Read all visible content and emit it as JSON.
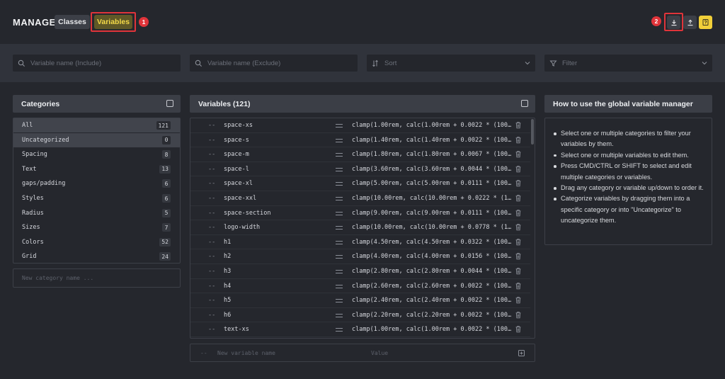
{
  "header": {
    "title": "MANAGE",
    "tabs": [
      {
        "label": "Classes",
        "active": false
      },
      {
        "label": "Variables",
        "active": true
      }
    ],
    "annotations": [
      "1",
      "2"
    ],
    "icons": [
      "download-icon",
      "upload-icon",
      "help-book-icon"
    ]
  },
  "filters": [
    {
      "placeholder": "Variable name (Include)",
      "icon": "search-icon"
    },
    {
      "placeholder": "Variable name (Exclude)",
      "icon": "search-icon"
    },
    {
      "placeholder": "Sort",
      "icon": "sort-icon"
    },
    {
      "placeholder": "Filter",
      "icon": "filter-icon"
    }
  ],
  "categories": {
    "title": "Categories",
    "items": [
      {
        "name": "All",
        "count": "121"
      },
      {
        "name": "Uncategorized",
        "count": "0"
      },
      {
        "name": "Spacing",
        "count": "8"
      },
      {
        "name": "Text",
        "count": "13"
      },
      {
        "name": "gaps/padding",
        "count": "6"
      },
      {
        "name": "Styles",
        "count": "6"
      },
      {
        "name": "Radius",
        "count": "5"
      },
      {
        "name": "Sizes",
        "count": "7"
      },
      {
        "name": "Colors",
        "count": "52"
      },
      {
        "name": "Grid",
        "count": "24"
      }
    ],
    "new_placeholder": "New category name ..."
  },
  "variables": {
    "title": "Variables (121)",
    "rows": [
      {
        "prefix": "--",
        "name": "space-xs",
        "value": "clamp(1.00rem, calc(1.00rem + 0.0022 * (100…"
      },
      {
        "prefix": "--",
        "name": "space-s",
        "value": "clamp(1.40rem, calc(1.40rem + 0.0022 * (100…"
      },
      {
        "prefix": "--",
        "name": "space-m",
        "value": "clamp(1.80rem, calc(1.80rem + 0.0067 * (100…"
      },
      {
        "prefix": "--",
        "name": "space-l",
        "value": "clamp(3.60rem, calc(3.60rem + 0.0044 * (100…"
      },
      {
        "prefix": "--",
        "name": "space-xl",
        "value": "clamp(5.00rem, calc(5.00rem + 0.0111 * (100…"
      },
      {
        "prefix": "--",
        "name": "space-xxl",
        "value": "clamp(10.00rem, calc(10.00rem + 0.0222 * (1…"
      },
      {
        "prefix": "--",
        "name": "space-section",
        "value": "clamp(9.00rem, calc(9.00rem + 0.0111 * (100…"
      },
      {
        "prefix": "--",
        "name": "logo-width",
        "value": "clamp(10.00rem, calc(10.00rem + 0.0778 * (1…"
      },
      {
        "prefix": "--",
        "name": "h1",
        "value": "clamp(4.50rem, calc(4.50rem + 0.0322 * (100…"
      },
      {
        "prefix": "--",
        "name": "h2",
        "value": "clamp(4.00rem, calc(4.00rem + 0.0156 * (100…"
      },
      {
        "prefix": "--",
        "name": "h3",
        "value": "clamp(2.80rem, calc(2.80rem + 0.0044 * (100…"
      },
      {
        "prefix": "--",
        "name": "h4",
        "value": "clamp(2.60rem, calc(2.60rem + 0.0022 * (100…"
      },
      {
        "prefix": "--",
        "name": "h5",
        "value": "clamp(2.40rem, calc(2.40rem + 0.0022 * (100…"
      },
      {
        "prefix": "--",
        "name": "h6",
        "value": "clamp(2.20rem, calc(2.20rem + 0.0022 * (100…"
      },
      {
        "prefix": "--",
        "name": "text-xs",
        "value": "clamp(1.00rem, calc(1.00rem + 0.0022 * (100…"
      }
    ],
    "new_row": {
      "prefix": "--",
      "name_placeholder": "New variable name",
      "value_placeholder": "Value"
    }
  },
  "help": {
    "title": "How to use the global variable manager",
    "items": [
      "Select one or multiple categories to filter your variables by them.",
      "Select one or multiple variables to edit them.",
      "Press CMD/CTRL or SHIFT to select and edit multiple categories or variables.",
      "Drag any category or variable up/down to order it.",
      "Categorize variables by dragging them into a specific category or into \"Uncategorize\" to uncategorize them."
    ]
  },
  "colors": {
    "background": "#25272d",
    "accent_yellow": "#f1cf39",
    "highlight_red": "#e0343a"
  }
}
